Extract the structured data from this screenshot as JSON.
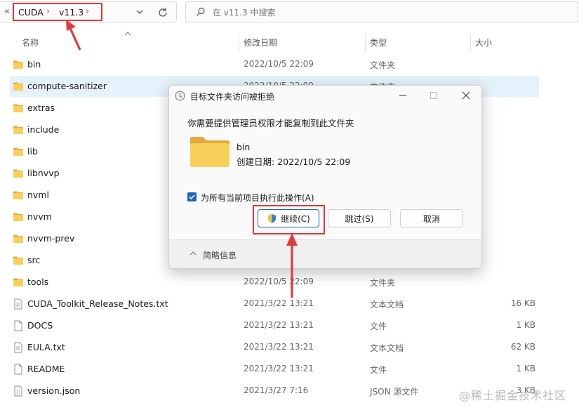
{
  "address": {
    "overflow": "«",
    "crumbs": [
      "CUDA",
      "v11.3"
    ],
    "sep": "›"
  },
  "search": {
    "placeholder": "在 v11.3 中搜索"
  },
  "columns": {
    "name": "名称",
    "date": "修改日期",
    "type": "类型",
    "size": "大小"
  },
  "files": [
    {
      "name": "bin",
      "date": "2022/10/5 22:09",
      "type": "文件夹",
      "size": "",
      "kind": "folder"
    },
    {
      "name": "compute-sanitizer",
      "date": "2022/10/5 22:09",
      "type": "文件夹",
      "size": "",
      "kind": "folder"
    },
    {
      "name": "extras",
      "date": "",
      "type": "",
      "size": "",
      "kind": "folder"
    },
    {
      "name": "include",
      "date": "",
      "type": "",
      "size": "",
      "kind": "folder"
    },
    {
      "name": "lib",
      "date": "",
      "type": "",
      "size": "",
      "kind": "folder"
    },
    {
      "name": "libnvvp",
      "date": "",
      "type": "",
      "size": "",
      "kind": "folder"
    },
    {
      "name": "nvml",
      "date": "",
      "type": "",
      "size": "",
      "kind": "folder"
    },
    {
      "name": "nvvm",
      "date": "",
      "type": "",
      "size": "",
      "kind": "folder"
    },
    {
      "name": "nvvm-prev",
      "date": "",
      "type": "",
      "size": "",
      "kind": "folder"
    },
    {
      "name": "src",
      "date": "",
      "type": "",
      "size": "",
      "kind": "folder"
    },
    {
      "name": "tools",
      "date": "2022/10/5 22:09",
      "type": "文件夹",
      "size": "",
      "kind": "folder"
    },
    {
      "name": "CUDA_Toolkit_Release_Notes.txt",
      "date": "2021/3/22 13:21",
      "type": "文本文档",
      "size": "16 KB",
      "kind": "text"
    },
    {
      "name": "DOCS",
      "date": "2021/3/22 13:21",
      "type": "文件",
      "size": "1 KB",
      "kind": "file"
    },
    {
      "name": "EULA.txt",
      "date": "2021/3/22 13:21",
      "type": "文本文档",
      "size": "62 KB",
      "kind": "text"
    },
    {
      "name": "README",
      "date": "2021/3/22 13:21",
      "type": "文件",
      "size": "1 KB",
      "kind": "file"
    },
    {
      "name": "version.json",
      "date": "2021/3/27 7:16",
      "type": "JSON 源文件",
      "size": "3 KB",
      "kind": "json"
    }
  ],
  "dialog": {
    "title": "目标文件夹访问被拒绝",
    "message": "你需要提供管理员权限才能复制到此文件夹",
    "folder_name": "bin",
    "folder_date": "创建日期: 2022/10/5 22:09",
    "checkbox_label": "为所有当前项目执行此操作(A)",
    "checkbox_checked": true,
    "continue_label": "继续(C)",
    "skip_label": "跳过(S)",
    "cancel_label": "取消",
    "details_label": "简略信息"
  },
  "watermark": "@稀土掘金技术社区",
  "colors": {
    "accent": "#1a63c0",
    "annotation": "#e03a3a",
    "folder": "#f7c54a"
  }
}
